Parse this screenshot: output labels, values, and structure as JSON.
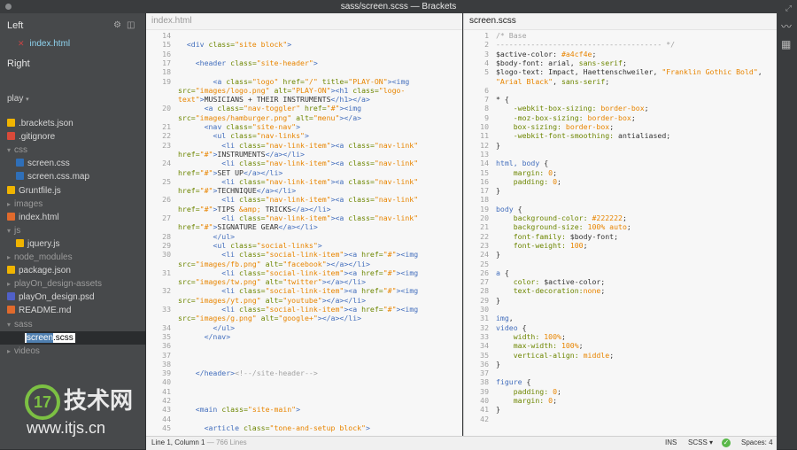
{
  "window": {
    "title": "sass/screen.scss — Brackets"
  },
  "sidebar": {
    "working_left_label": "Left",
    "working_right_label": "Right",
    "open_file": "index.html",
    "project_name": "play",
    "tree": [
      {
        "label": ".brackets.json",
        "kind": "file",
        "icon_color": "#f0b400",
        "depth": 0
      },
      {
        "label": ".gitignore",
        "kind": "file",
        "icon_color": "#d94a3a",
        "depth": 0
      },
      {
        "label": "css",
        "kind": "folder",
        "depth": 0,
        "open": true
      },
      {
        "label": "screen.css",
        "kind": "file",
        "icon_color": "#2f6fb8",
        "depth": 1
      },
      {
        "label": "screen.css.map",
        "kind": "file",
        "icon_color": "#2f6fb8",
        "depth": 1
      },
      {
        "label": "Gruntfile.js",
        "kind": "file",
        "icon_color": "#f0b400",
        "depth": 0
      },
      {
        "label": "images",
        "kind": "folder",
        "depth": 0,
        "open": false
      },
      {
        "label": "index.html",
        "kind": "file",
        "icon_color": "#e06a2c",
        "depth": 0
      },
      {
        "label": "js",
        "kind": "folder",
        "depth": 0,
        "open": true
      },
      {
        "label": "jquery.js",
        "kind": "file",
        "icon_color": "#f0b400",
        "depth": 1
      },
      {
        "label": "node_modules",
        "kind": "folder",
        "depth": 0,
        "open": false
      },
      {
        "label": "package.json",
        "kind": "file",
        "icon_color": "#f0b400",
        "depth": 0
      },
      {
        "label": "playOn_design-assets",
        "kind": "folder",
        "depth": 0,
        "open": false
      },
      {
        "label": "playOn_design.psd",
        "kind": "file",
        "icon_color": "#5060c8",
        "depth": 0
      },
      {
        "label": "README.md",
        "kind": "file",
        "icon_color": "#e06a2c",
        "depth": 0
      },
      {
        "label": "sass",
        "kind": "folder",
        "depth": 0,
        "open": true
      },
      {
        "label": "screen.scss",
        "kind": "editing",
        "depth": 1
      },
      {
        "label": "videos",
        "kind": "folder",
        "depth": 0,
        "open": false
      }
    ]
  },
  "left_editor": {
    "filename": "index.html",
    "lines": [
      {
        "n": "14",
        "html": "   "
      },
      {
        "n": "15",
        "html": "  <span class='t'>&lt;div</span> <span class='a'>class=</span><span class='s'>\"site block\"</span><span class='t'>&gt;</span>"
      },
      {
        "n": "16",
        "html": ""
      },
      {
        "n": "17",
        "html": "    <span class='t'>&lt;header</span> <span class='a'>class=</span><span class='s'>\"site-header\"</span><span class='t'>&gt;</span>"
      },
      {
        "n": "18",
        "html": ""
      },
      {
        "n": "19",
        "html": "        <span class='t'>&lt;a</span> <span class='a'>class=</span><span class='s'>\"logo\"</span> <span class='a'>href=</span><span class='s'>\"/\"</span> <span class='a'>title=</span><span class='s'>\"PLAY-ON\"</span><span class='t'>&gt;&lt;img</span>"
      },
      {
        "n": "",
        "html": "<span class='a'>src=</span><span class='s'>\"images/logo.png\"</span> <span class='a'>alt=</span><span class='s'>\"PLAY-ON\"</span><span class='t'>&gt;&lt;h1</span> <span class='a'>class=</span><span class='s'>\"logo-</span>"
      },
      {
        "n": "",
        "html": "<span class='s'>text\"</span><span class='t'>&gt;</span>MUSICIANS + THEIR INSTRUMENTS<span class='t'>&lt;/h1&gt;&lt;/a&gt;</span>"
      },
      {
        "n": "20",
        "html": "      <span class='t'>&lt;a</span> <span class='a'>class=</span><span class='s'>\"nav-toggler\"</span> <span class='a'>href=</span><span class='s'>\"#\"</span><span class='t'>&gt;&lt;img</span>"
      },
      {
        "n": "",
        "html": "<span class='a'>src=</span><span class='s'>\"images/hamburger.png\"</span> <span class='a'>alt=</span><span class='s'>\"menu\"</span><span class='t'>&gt;&lt;/a&gt;</span>"
      },
      {
        "n": "21",
        "html": "      <span class='t'>&lt;nav</span> <span class='a'>class=</span><span class='s'>\"site-nav\"</span><span class='t'>&gt;</span>"
      },
      {
        "n": "22",
        "html": "        <span class='t'>&lt;ul</span> <span class='a'>class=</span><span class='s'>\"nav-links\"</span><span class='t'>&gt;</span>"
      },
      {
        "n": "23",
        "html": "          <span class='t'>&lt;li</span> <span class='a'>class=</span><span class='s'>\"nav-link-item\"</span><span class='t'>&gt;&lt;a</span> <span class='a'>class=</span><span class='s'>\"nav-link\"</span>"
      },
      {
        "n": "",
        "html": "<span class='a'>href=</span><span class='s'>\"#\"</span><span class='t'>&gt;</span>INSTRUMENTS<span class='t'>&lt;/a&gt;&lt;/li&gt;</span>"
      },
      {
        "n": "24",
        "html": "          <span class='t'>&lt;li</span> <span class='a'>class=</span><span class='s'>\"nav-link-item\"</span><span class='t'>&gt;&lt;a</span> <span class='a'>class=</span><span class='s'>\"nav-link\"</span>"
      },
      {
        "n": "",
        "html": "<span class='a'>href=</span><span class='s'>\"#\"</span><span class='t'>&gt;</span>SET UP<span class='t'>&lt;/a&gt;&lt;/li&gt;</span>"
      },
      {
        "n": "25",
        "html": "          <span class='t'>&lt;li</span> <span class='a'>class=</span><span class='s'>\"nav-link-item\"</span><span class='t'>&gt;&lt;a</span> <span class='a'>class=</span><span class='s'>\"nav-link\"</span>"
      },
      {
        "n": "",
        "html": "<span class='a'>href=</span><span class='s'>\"#\"</span><span class='t'>&gt;</span>TECHNIQUE<span class='t'>&lt;/a&gt;&lt;/li&gt;</span>"
      },
      {
        "n": "26",
        "html": "          <span class='t'>&lt;li</span> <span class='a'>class=</span><span class='s'>\"nav-link-item\"</span><span class='t'>&gt;&lt;a</span> <span class='a'>class=</span><span class='s'>\"nav-link\"</span>"
      },
      {
        "n": "",
        "html": "<span class='a'>href=</span><span class='s'>\"#\"</span><span class='t'>&gt;</span>TIPS <span class='s'>&amp;amp;</span> TRICKS<span class='t'>&lt;/a&gt;&lt;/li&gt;</span>"
      },
      {
        "n": "27",
        "html": "          <span class='t'>&lt;li</span> <span class='a'>class=</span><span class='s'>\"nav-link-item\"</span><span class='t'>&gt;&lt;a</span> <span class='a'>class=</span><span class='s'>\"nav-link\"</span>"
      },
      {
        "n": "",
        "html": "<span class='a'>href=</span><span class='s'>\"#\"</span><span class='t'>&gt;</span>SIGNATURE GEAR<span class='t'>&lt;/a&gt;&lt;/li&gt;</span>"
      },
      {
        "n": "28",
        "html": "        <span class='t'>&lt;/ul&gt;</span>"
      },
      {
        "n": "29",
        "html": "        <span class='t'>&lt;ul</span> <span class='a'>class=</span><span class='s'>\"social-links\"</span><span class='t'>&gt;</span>"
      },
      {
        "n": "30",
        "html": "          <span class='t'>&lt;li</span> <span class='a'>class=</span><span class='s'>\"social-link-item\"</span><span class='t'>&gt;&lt;a</span> <span class='a'>href=</span><span class='s'>\"#\"</span><span class='t'>&gt;&lt;img</span>"
      },
      {
        "n": "",
        "html": "<span class='a'>src=</span><span class='s'>\"images/fb.png\"</span> <span class='a'>alt=</span><span class='s'>\"facebook\"</span><span class='t'>&gt;&lt;/a&gt;&lt;/li&gt;</span>"
      },
      {
        "n": "31",
        "html": "          <span class='t'>&lt;li</span> <span class='a'>class=</span><span class='s'>\"social-link-item\"</span><span class='t'>&gt;&lt;a</span> <span class='a'>href=</span><span class='s'>\"#\"</span><span class='t'>&gt;&lt;img</span>"
      },
      {
        "n": "",
        "html": "<span class='a'>src=</span><span class='s'>\"images/tw.png\"</span> <span class='a'>alt=</span><span class='s'>\"twitter\"</span><span class='t'>&gt;&lt;/a&gt;&lt;/li&gt;</span>"
      },
      {
        "n": "32",
        "html": "          <span class='t'>&lt;li</span> <span class='a'>class=</span><span class='s'>\"social-link-item\"</span><span class='t'>&gt;&lt;a</span> <span class='a'>href=</span><span class='s'>\"#\"</span><span class='t'>&gt;&lt;img</span>"
      },
      {
        "n": "",
        "html": "<span class='a'>src=</span><span class='s'>\"images/yt.png\"</span> <span class='a'>alt=</span><span class='s'>\"youtube\"</span><span class='t'>&gt;&lt;/a&gt;&lt;/li&gt;</span>"
      },
      {
        "n": "33",
        "html": "          <span class='t'>&lt;li</span> <span class='a'>class=</span><span class='s'>\"social-link-item\"</span><span class='t'>&gt;&lt;a</span> <span class='a'>href=</span><span class='s'>\"#\"</span><span class='t'>&gt;&lt;img</span>"
      },
      {
        "n": "",
        "html": "<span class='a'>src=</span><span class='s'>\"images/g.png\"</span> <span class='a'>alt=</span><span class='s'>\"google+\"</span><span class='t'>&gt;&lt;/a&gt;&lt;/li&gt;</span>"
      },
      {
        "n": "34",
        "html": "        <span class='t'>&lt;/ul&gt;</span>"
      },
      {
        "n": "35",
        "html": "      <span class='t'>&lt;/nav&gt;</span>"
      },
      {
        "n": "36",
        "html": ""
      },
      {
        "n": "37",
        "html": ""
      },
      {
        "n": "38",
        "html": ""
      },
      {
        "n": "39",
        "html": "    <span class='t'>&lt;/header&gt;</span><span class='c'>&lt;!--/site-header--&gt;</span>"
      },
      {
        "n": "40",
        "html": ""
      },
      {
        "n": "41",
        "html": ""
      },
      {
        "n": "42",
        "html": ""
      },
      {
        "n": "43",
        "html": "    <span class='t'>&lt;main</span> <span class='a'>class=</span><span class='s'>\"site-main\"</span><span class='t'>&gt;</span>"
      },
      {
        "n": "44",
        "html": ""
      },
      {
        "n": "45",
        "html": "      <span class='t'>&lt;article</span> <span class='a'>class=</span><span class='s'>\"tone-and-setup block\"</span><span class='t'>&gt;</span>"
      }
    ]
  },
  "right_editor": {
    "filename": "screen.scss",
    "lines": [
      {
        "n": "1",
        "html": "<span class='c'>/* Base</span>"
      },
      {
        "n": "2",
        "html": "<span class='c'>-------------------------------------- */</span>"
      },
      {
        "n": "3",
        "html": "$active-color: <span class='v'>#a4cf4e</span>;"
      },
      {
        "n": "4",
        "html": "$body-font: arial, <span class='p'>sans-serif</span>;"
      },
      {
        "n": "5",
        "html": "$logo-text: Impact, Haettenschweiler, <span class='v'>\"Franklin Gothic Bold\"</span>,"
      },
      {
        "n": "",
        "html": "<span class='v'>\"Arial Black\"</span>, <span class='p'>sans-serif</span>;"
      },
      {
        "n": "6",
        "html": ""
      },
      {
        "n": "7",
        "html": "* {"
      },
      {
        "n": "8",
        "html": "    <span class='p'>-webkit-box-sizing:</span> <span class='v'>border-box</span>;"
      },
      {
        "n": "9",
        "html": "    <span class='p'>-moz-box-sizing:</span> <span class='v'>border-box</span>;"
      },
      {
        "n": "10",
        "html": "    <span class='p'>box-sizing:</span> <span class='v'>border-box</span>;"
      },
      {
        "n": "11",
        "html": "    <span class='p'>-webkit-font-smoothing:</span> antialiased;"
      },
      {
        "n": "12",
        "html": "}"
      },
      {
        "n": "13",
        "html": ""
      },
      {
        "n": "14",
        "html": "<span class='sel'>html, body</span> {"
      },
      {
        "n": "15",
        "html": "    <span class='p'>margin:</span> <span class='v'>0</span>;"
      },
      {
        "n": "16",
        "html": "    <span class='p'>padding:</span> <span class='v'>0</span>;"
      },
      {
        "n": "17",
        "html": "}"
      },
      {
        "n": "18",
        "html": ""
      },
      {
        "n": "19",
        "html": "<span class='sel'>body</span> {"
      },
      {
        "n": "20",
        "html": "    <span class='p'>background-color:</span> <span class='v'>#222222</span>;"
      },
      {
        "n": "21",
        "html": "    <span class='p'>background-size:</span> <span class='v'>100% auto</span>;"
      },
      {
        "n": "22",
        "html": "    <span class='p'>font-family:</span> $body-font;"
      },
      {
        "n": "23",
        "html": "    <span class='p'>font-weight:</span> <span class='v'>100</span>;"
      },
      {
        "n": "24",
        "html": "}"
      },
      {
        "n": "25",
        "html": ""
      },
      {
        "n": "26",
        "html": "<span class='sel'>a</span> {"
      },
      {
        "n": "27",
        "html": "    <span class='p'>color:</span> $active-color;"
      },
      {
        "n": "28",
        "html": "    <span class='p'>text-decoration:</span><span class='v'>none</span>;"
      },
      {
        "n": "29",
        "html": "}"
      },
      {
        "n": "30",
        "html": ""
      },
      {
        "n": "31",
        "html": "<span class='sel'>img</span>,"
      },
      {
        "n": "32",
        "html": "<span class='sel'>video</span> {"
      },
      {
        "n": "33",
        "html": "    <span class='p'>width:</span> <span class='v'>100%</span>;"
      },
      {
        "n": "34",
        "html": "    <span class='p'>max-width:</span> <span class='v'>100%</span>;"
      },
      {
        "n": "35",
        "html": "    <span class='p'>vertical-align:</span> <span class='v'>middle</span>;"
      },
      {
        "n": "36",
        "html": "}"
      },
      {
        "n": "37",
        "html": ""
      },
      {
        "n": "38",
        "html": "<span class='sel'>figure</span> {"
      },
      {
        "n": "39",
        "html": "    <span class='p'>padding:</span> <span class='v'>0</span>;"
      },
      {
        "n": "40",
        "html": "    <span class='p'>margin:</span> <span class='v'>0</span>;"
      },
      {
        "n": "41",
        "html": "}"
      },
      {
        "n": "42",
        "html": ""
      }
    ]
  },
  "status_bar": {
    "position": "Line 1, Column 1",
    "line_count": "— 766 Lines",
    "ins": "INS",
    "mode": "SCSS ▾",
    "spaces": "Spaces: 4"
  },
  "watermark": {
    "logo_text": "17",
    "site_name": "技术网",
    "url": "www.itjs.cn"
  }
}
